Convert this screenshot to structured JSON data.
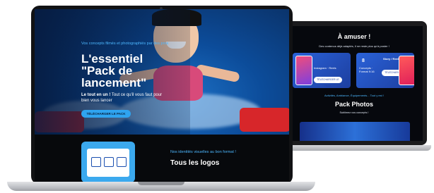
{
  "back_screen": {
    "title": "À amuser !",
    "subtitle": "Des contenus déjà adaptés, il ne reste plus qu'à poster !",
    "card1": {
      "big": "",
      "small": "Instagram · Reels",
      "button": "TÉLÉCHARGER LE PACK"
    },
    "card2": {
      "big": "8",
      "small": "Concepts · Format 9:16",
      "button": "TÉLÉCHARGER LE PACK",
      "tag": "Story / Reel"
    },
    "description": "Activités, Ambiance, Équipements... Tout y est !",
    "photos_title": "Pack Photos",
    "photos_subtitle": "Sublimez vos concepts !"
  },
  "front_screen": {
    "hero": {
      "kicker": "Vos concepts filmés et photographiés par des pros",
      "title": "L'essentiel \"Pack de lancement\"",
      "description_bold": "Le tout en un !",
      "description_rest": " Tout ce qu'il vous faut pour bien vous lancer",
      "button": "TÉLÉCHARGER LE PACK"
    },
    "section2": {
      "kicker": "Nos identités visuelles au bon format !",
      "title": "Tous les logos"
    }
  }
}
